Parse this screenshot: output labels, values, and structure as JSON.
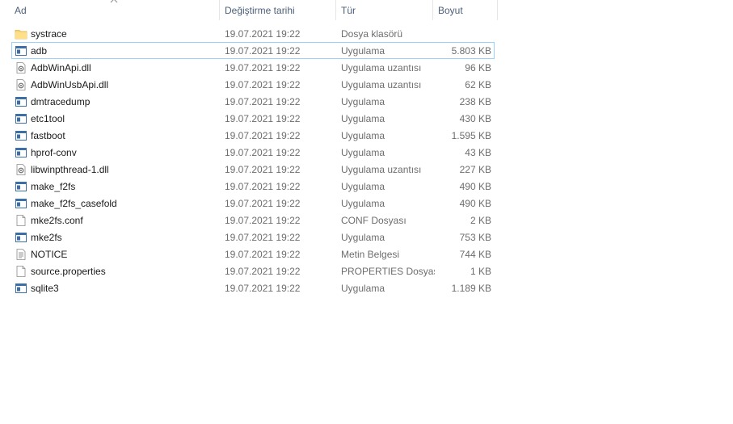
{
  "columns": {
    "name": "Ad",
    "date": "Değiştirme tarihi",
    "type": "Tür",
    "size": "Boyut"
  },
  "sort_icon": "chevron-up-icon",
  "selected_row": 1,
  "files": [
    {
      "name": "systrace",
      "date": "19.07.2021 19:22",
      "type": "Dosya klasörü",
      "size": "",
      "icon": "folder-icon"
    },
    {
      "name": "adb",
      "date": "19.07.2021 19:22",
      "type": "Uygulama",
      "size": "5.803 KB",
      "icon": "application-icon"
    },
    {
      "name": "AdbWinApi.dll",
      "date": "19.07.2021 19:22",
      "type": "Uygulama uzantısı",
      "size": "96 KB",
      "icon": "dll-icon"
    },
    {
      "name": "AdbWinUsbApi.dll",
      "date": "19.07.2021 19:22",
      "type": "Uygulama uzantısı",
      "size": "62 KB",
      "icon": "dll-icon"
    },
    {
      "name": "dmtracedump",
      "date": "19.07.2021 19:22",
      "type": "Uygulama",
      "size": "238 KB",
      "icon": "application-icon"
    },
    {
      "name": "etc1tool",
      "date": "19.07.2021 19:22",
      "type": "Uygulama",
      "size": "430 KB",
      "icon": "application-icon"
    },
    {
      "name": "fastboot",
      "date": "19.07.2021 19:22",
      "type": "Uygulama",
      "size": "1.595 KB",
      "icon": "application-icon"
    },
    {
      "name": "hprof-conv",
      "date": "19.07.2021 19:22",
      "type": "Uygulama",
      "size": "43 KB",
      "icon": "application-icon"
    },
    {
      "name": "libwinpthread-1.dll",
      "date": "19.07.2021 19:22",
      "type": "Uygulama uzantısı",
      "size": "227 KB",
      "icon": "dll-icon"
    },
    {
      "name": "make_f2fs",
      "date": "19.07.2021 19:22",
      "type": "Uygulama",
      "size": "490 KB",
      "icon": "application-icon"
    },
    {
      "name": "make_f2fs_casefold",
      "date": "19.07.2021 19:22",
      "type": "Uygulama",
      "size": "490 KB",
      "icon": "application-icon"
    },
    {
      "name": "mke2fs.conf",
      "date": "19.07.2021 19:22",
      "type": "CONF Dosyası",
      "size": "2 KB",
      "icon": "file-icon"
    },
    {
      "name": "mke2fs",
      "date": "19.07.2021 19:22",
      "type": "Uygulama",
      "size": "753 KB",
      "icon": "application-icon"
    },
    {
      "name": "NOTICE",
      "date": "19.07.2021 19:22",
      "type": "Metin Belgesi",
      "size": "744 KB",
      "icon": "text-document-icon"
    },
    {
      "name": "source.properties",
      "date": "19.07.2021 19:22",
      "type": "PROPERTIES Dosyası",
      "size": "1 KB",
      "icon": "file-icon"
    },
    {
      "name": "sqlite3",
      "date": "19.07.2021 19:22",
      "type": "Uygulama",
      "size": "1.189 KB",
      "icon": "application-icon"
    }
  ]
}
